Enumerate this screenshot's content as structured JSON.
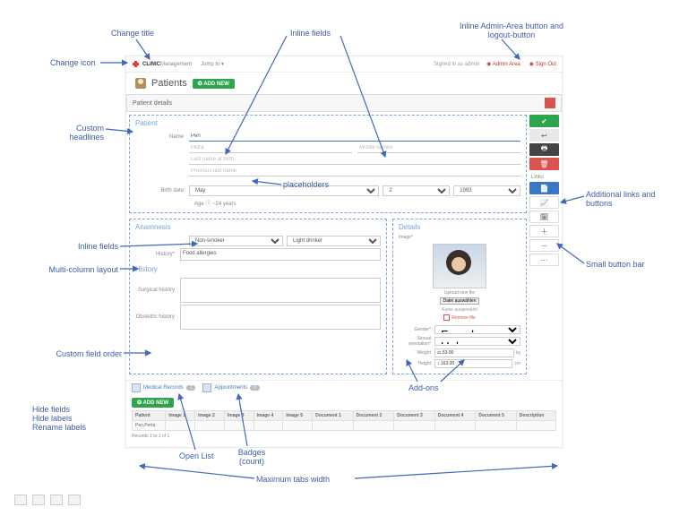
{
  "annotations": {
    "change_title": "Change title",
    "change_icon": "Change icon",
    "inline_fields": "Inline fields",
    "inline_admin": "Inline Admin-Area button and logout-button",
    "custom_headlines": "Custom headlines",
    "placeholders": "placeholders",
    "additional_links": "Additional links and buttons",
    "inline_fields2": "Inline fields",
    "multi_column": "Multi-column layout",
    "small_btn_bar": "Small button bar",
    "custom_field_order": "Custom field order",
    "add_ons": "Add-ons",
    "hide_fields": "Hide fields\nHide labels\nRename labels",
    "open_list": "Open List",
    "badges": "Badges (count)",
    "max_tabs": "Maximum tabs width"
  },
  "topbar": {
    "brand1": "CLINIC",
    "brand2": "Management",
    "jumpto": "Jump to ▾",
    "signed": "Signed in as admin",
    "admin_area": "◉ Admin Area",
    "signout": "◉ Sign Out"
  },
  "page": {
    "title": "Patients",
    "addnew": "✪ ADD NEW",
    "details_bar": "Patient details"
  },
  "patient": {
    "head": "Patient",
    "name_label": "Name",
    "name_value": "Pen",
    "first_ph": "Petra",
    "middle_ph": "Middle names",
    "last_ph": "Last name at birth",
    "prev_ph": "Previous last name",
    "birth_label": "Birth date",
    "month": "May",
    "day": "2",
    "year": "1993",
    "age_label": "Age",
    "age_value": "~24 years"
  },
  "anamnesis": {
    "head": "Anamnesis",
    "smoker": "Non-smoker",
    "drinker": "Light drinker",
    "history_label": "History*",
    "history_val": "Food allergies"
  },
  "history": {
    "head": "History",
    "surgical": "Surgical history",
    "obstetric": "Obstetric history"
  },
  "details": {
    "head": "Details",
    "image_label": "Image*",
    "upload": "Upload new file",
    "choose": "Datei auswählen",
    "nofile": "Keine ausgewählt",
    "remove": "Remove file",
    "gender_label": "Gender*",
    "gender_val": "Female",
    "sexor_label": "Sexual orientation*",
    "sexor_val": "Unknown",
    "weight_label": "Weight",
    "weight_val": "53.00",
    "weight_unit": "kg",
    "height_label": "Height",
    "height_val": "163.00",
    "height_unit": "cm"
  },
  "sidebar": {
    "links_label": "Links"
  },
  "tabs": {
    "medrec": "Medical Records",
    "medrec_badge": "1",
    "appt": "Appointments",
    "appt_badge": "0"
  },
  "table": {
    "addnew": "✪ ADD NEW",
    "cols": [
      "Patient",
      "Image 1",
      "Image 2",
      "Image 3",
      "Image 4",
      "Image 5",
      "Document 1",
      "Document 2",
      "Document 3",
      "Document 4",
      "Document 5",
      "Description"
    ],
    "row0": "Pen,Petra",
    "records": "Records 1 to 1 of 1"
  }
}
